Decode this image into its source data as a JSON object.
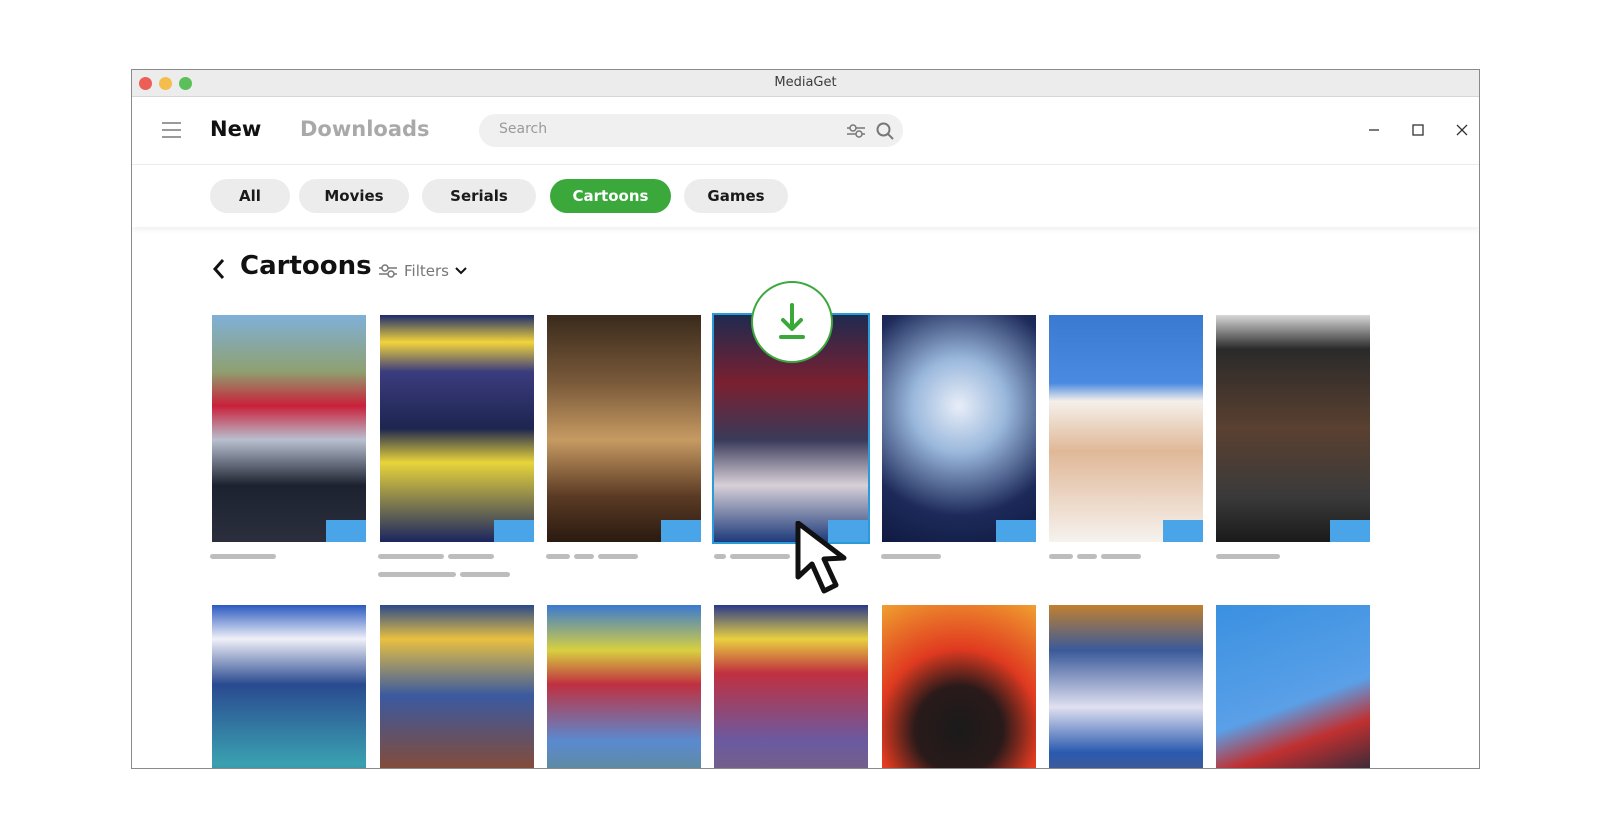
{
  "window": {
    "title": "MediaGet"
  },
  "header": {
    "nav_new": "New",
    "nav_downloads": "Downloads",
    "search_placeholder": "Search"
  },
  "categories": [
    {
      "label": "All",
      "active": false
    },
    {
      "label": "Movies",
      "active": false
    },
    {
      "label": "Serials",
      "active": false
    },
    {
      "label": "Cartoons",
      "active": true
    },
    {
      "label": "Games",
      "active": false
    }
  ],
  "section": {
    "title": "Cartoons",
    "filters_label": "Filters"
  },
  "colors": {
    "accent": "#3aa83a",
    "selection": "#2a9bd8",
    "badge": "#4aa4e8"
  },
  "icons": [
    "menu-icon",
    "filter-sliders-icon",
    "search-icon",
    "minimize-icon",
    "maximize-icon",
    "close-icon",
    "back-chevron-icon",
    "chevron-down-icon",
    "download-icon",
    "cursor-arrow-icon"
  ]
}
